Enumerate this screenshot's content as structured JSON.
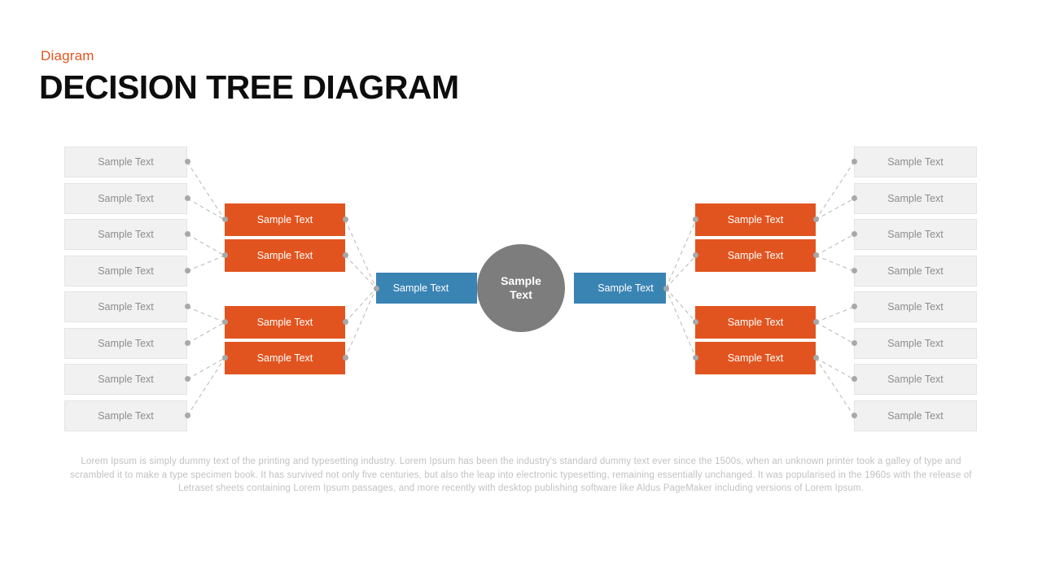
{
  "header": {
    "kicker": "Diagram",
    "title": "DECISION TREE DIAGRAM",
    "kicker_color": "#e2551f",
    "title_color": "#0d0d0d"
  },
  "colors": {
    "accent_orange": "#e2541f",
    "accent_blue": "#3a84b4",
    "root_gray": "#7d7d7d",
    "leaf_gray": "#f1f1f1",
    "leaf_border": "#e4e4e4",
    "leaf_text": "#8e8e8e",
    "connector": "#bdbdbd",
    "dot": "#a8a8a8",
    "footer_text": "#c2c2c2"
  },
  "root": {
    "label_line1": "Sample",
    "label_line2": "Text"
  },
  "trunk": {
    "left": {
      "label": "Sample Text"
    },
    "right": {
      "label": "Sample Text"
    }
  },
  "left_branches": [
    {
      "label": "Sample Text"
    },
    {
      "label": "Sample Text"
    },
    {
      "label": "Sample Text"
    },
    {
      "label": "Sample Text"
    }
  ],
  "right_branches": [
    {
      "label": "Sample Text"
    },
    {
      "label": "Sample Text"
    },
    {
      "label": "Sample Text"
    },
    {
      "label": "Sample Text"
    }
  ],
  "left_leaves": [
    {
      "label": "Sample Text"
    },
    {
      "label": "Sample Text"
    },
    {
      "label": "Sample Text"
    },
    {
      "label": "Sample Text"
    },
    {
      "label": "Sample Text"
    },
    {
      "label": "Sample Text"
    },
    {
      "label": "Sample Text"
    },
    {
      "label": "Sample Text"
    }
  ],
  "right_leaves": [
    {
      "label": "Sample Text"
    },
    {
      "label": "Sample Text"
    },
    {
      "label": "Sample Text"
    },
    {
      "label": "Sample Text"
    },
    {
      "label": "Sample Text"
    },
    {
      "label": "Sample Text"
    },
    {
      "label": "Sample Text"
    },
    {
      "label": "Sample Text"
    }
  ],
  "footer": {
    "text": "Lorem Ipsum is simply dummy text of the printing and typesetting industry. Lorem Ipsum has been the industry's standard dummy text ever since the 1500s, when an unknown printer took a galley of type and scrambled it to make a type specimen book. It has survived not only five centuries, but also the leap into electronic typesetting, remaining essentially unchanged. It was popularised in the 1960s with the release of Letraset sheets containing Lorem Ipsum passages, and more recently with desktop publishing software like Aldus PageMaker including versions of Lorem Ipsum."
  }
}
